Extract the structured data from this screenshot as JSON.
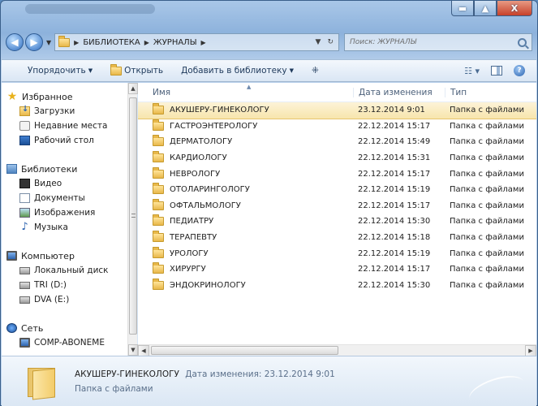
{
  "window": {
    "buttons": {
      "minimize": "▬",
      "maximize": "▲",
      "close": "X"
    }
  },
  "address": {
    "crumbs": [
      "БИБЛИОТЕКА",
      "ЖУРНАЛЫ"
    ],
    "search_placeholder": "Поиск: ЖУРНАЛЫ"
  },
  "toolbar": {
    "organize": "Упорядочить",
    "open": "Открыть",
    "add_to_library": "Добавить в библиотеку"
  },
  "nav": {
    "favorites": "Избранное",
    "downloads": "Загрузки",
    "recent": "Недавние места",
    "desktop": "Рабочий стол",
    "libraries": "Библиотеки",
    "video": "Видео",
    "documents": "Документы",
    "images": "Изображения",
    "music": "Музыка",
    "computer": "Компьютер",
    "local_disk": "Локальный диск",
    "drive_d": "TRI (D:)",
    "drive_e": "DVA (E:)",
    "network": "Сеть",
    "comp": "COMP-ABONEME"
  },
  "columns": {
    "name": "Имя",
    "date": "Дата изменения",
    "type": "Тип"
  },
  "files": [
    {
      "name": "АКУШЕРУ-ГИНЕКОЛОГУ",
      "date": "23.12.2014 9:01",
      "type": "Папка с файлами"
    },
    {
      "name": "ГАСТРОЭНТЕРОЛОГУ",
      "date": "22.12.2014 15:17",
      "type": "Папка с файлами"
    },
    {
      "name": "ДЕРМАТОЛОГУ",
      "date": "22.12.2014 15:49",
      "type": "Папка с файлами"
    },
    {
      "name": "КАРДИОЛОГУ",
      "date": "22.12.2014 15:31",
      "type": "Папка с файлами"
    },
    {
      "name": "НЕВРОЛОГУ",
      "date": "22.12.2014 15:17",
      "type": "Папка с файлами"
    },
    {
      "name": "ОТОЛАРИНГОЛОГУ",
      "date": "22.12.2014 15:19",
      "type": "Папка с файлами"
    },
    {
      "name": "ОФТАЛЬМОЛОГУ",
      "date": "22.12.2014 15:17",
      "type": "Папка с файлами"
    },
    {
      "name": "ПЕДИАТРУ",
      "date": "22.12.2014 15:30",
      "type": "Папка с файлами"
    },
    {
      "name": "ТЕРАПЕВТУ",
      "date": "22.12.2014 15:18",
      "type": "Папка с файлами"
    },
    {
      "name": "УРОЛОГУ",
      "date": "22.12.2014 15:19",
      "type": "Папка с файлами"
    },
    {
      "name": "ХИРУРГУ",
      "date": "22.12.2014 15:17",
      "type": "Папка с файлами"
    },
    {
      "name": "ЭНДОКРИНОЛОГУ",
      "date": "22.12.2014 15:30",
      "type": "Папка с файлами"
    }
  ],
  "details": {
    "name": "АКУШЕРУ-ГИНЕКОЛОГУ",
    "modified": "Дата изменения: 23.12.2014 9:01",
    "kind": "Папка с файлами"
  }
}
